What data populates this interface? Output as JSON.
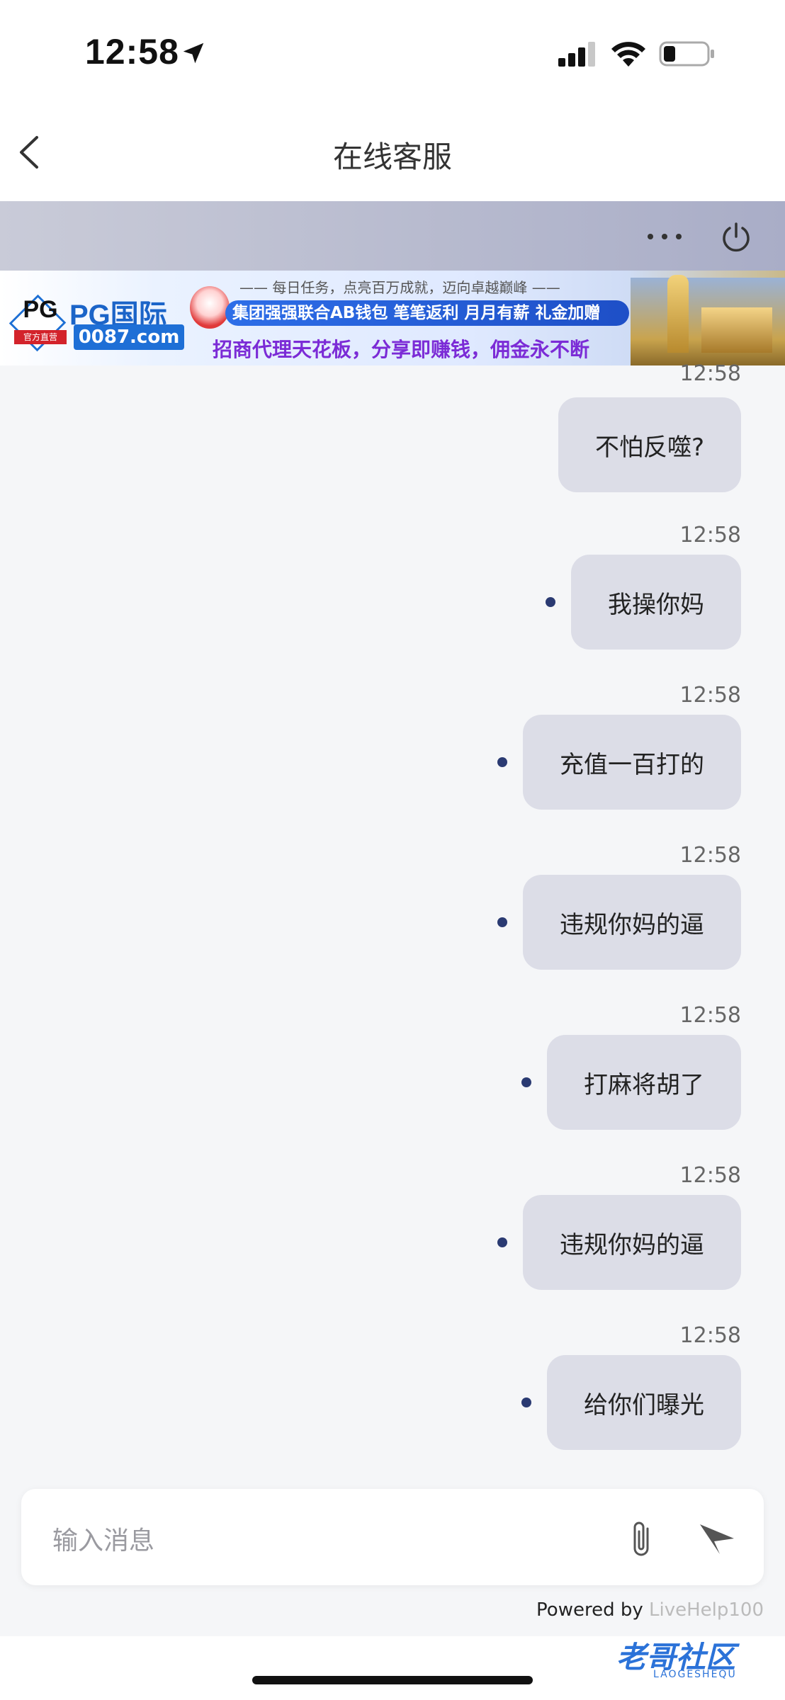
{
  "status_bar": {
    "time": "12:58"
  },
  "nav": {
    "title": "在线客服"
  },
  "banner": {
    "brand_logo": "PG",
    "brand_logo_sub": "官方直营",
    "brand_name": "PG国际",
    "domain": "0087.com",
    "top_line": "—— 每日任务，点亮百万成就，迈向卓越巅峰 ——",
    "mid_line": "集团强强联合AB钱包 笔笔返利 月月有薪 礼金加赠",
    "bottom_line": "招商代理天花板，分享即赚钱，佣金永不断"
  },
  "messages": [
    {
      "time": "12:58",
      "text": "不怕反噬?",
      "sent_dot": false
    },
    {
      "time": "12:58",
      "text": "我操你妈",
      "sent_dot": true
    },
    {
      "time": "12:58",
      "text": "充值一百打的",
      "sent_dot": true
    },
    {
      "time": "12:58",
      "text": "违规你妈的逼",
      "sent_dot": true
    },
    {
      "time": "12:58",
      "text": "打麻将胡了",
      "sent_dot": true
    },
    {
      "time": "12:58",
      "text": "违规你妈的逼",
      "sent_dot": true
    },
    {
      "time": "12:58",
      "text": "给你们曝光",
      "sent_dot": true
    }
  ],
  "input": {
    "placeholder": "输入消息"
  },
  "footer": {
    "powered_prefix": "Powered by",
    "powered_brand": "LiveHelp100"
  },
  "watermark": {
    "text": "老哥社区",
    "sub": "LAOGESHEQU"
  },
  "colors": {
    "bubble": "#dcdde7",
    "dot": "#2a3a72",
    "header_gradient_end": "#a9adc7"
  }
}
